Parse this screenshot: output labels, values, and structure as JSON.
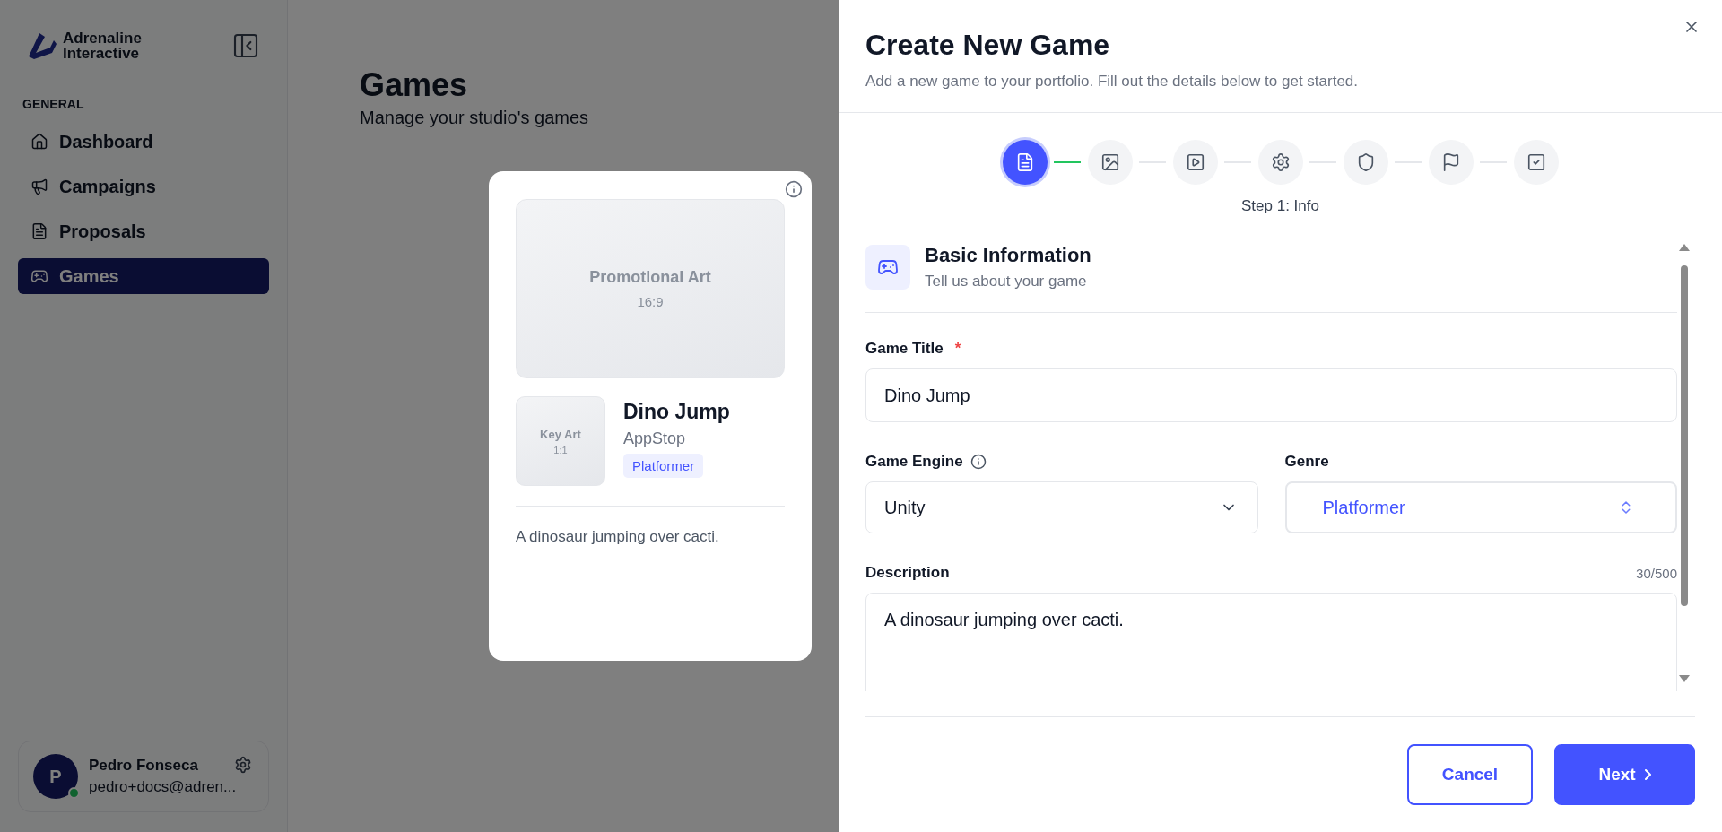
{
  "sidebar": {
    "brand": [
      "Adrenaline",
      "Interactive"
    ],
    "section": "GENERAL",
    "items": [
      {
        "label": "Dashboard",
        "selected": false
      },
      {
        "label": "Campaigns",
        "selected": false
      },
      {
        "label": "Proposals",
        "selected": false
      },
      {
        "label": "Games",
        "selected": true
      }
    ],
    "user": {
      "initial": "P",
      "name": "Pedro Fonseca",
      "email": "pedro+docs@adren...",
      "online": true
    }
  },
  "page": {
    "title": "Games",
    "subtitle": "Manage your studio's games"
  },
  "preview": {
    "promo_label": "Promotional Art",
    "promo_ratio": "16:9",
    "key_label": "Key Art",
    "key_ratio": "1:1",
    "title": "Dino Jump",
    "store": "AppStop",
    "genre": "Platformer",
    "description": "A dinosaur jumping over cacti."
  },
  "drawer": {
    "title": "Create New Game",
    "subtitle": "Add a new game to your portfolio. Fill out the details below to get started.",
    "steps": [
      {
        "selected": true,
        "line_done": true
      },
      {
        "selected": false,
        "line_done": false
      },
      {
        "selected": false,
        "line_done": false
      },
      {
        "selected": false,
        "line_done": false
      },
      {
        "selected": false,
        "line_done": false
      },
      {
        "selected": false,
        "line_done": false
      },
      {
        "selected": false
      }
    ],
    "step_label": "Step 1: Info",
    "section": {
      "title": "Basic Information",
      "subtitle": "Tell us about your game"
    },
    "game_title": {
      "label": "Game Title",
      "required_mark": "*",
      "value": "Dino Jump"
    },
    "engine": {
      "label": "Game Engine",
      "value": "Unity"
    },
    "genre": {
      "label": "Genre",
      "value": "Platformer"
    },
    "description": {
      "label": "Description",
      "counter": "30/500",
      "value": "A dinosaur jumping over cacti."
    },
    "cancel": "Cancel",
    "next": "Next"
  }
}
